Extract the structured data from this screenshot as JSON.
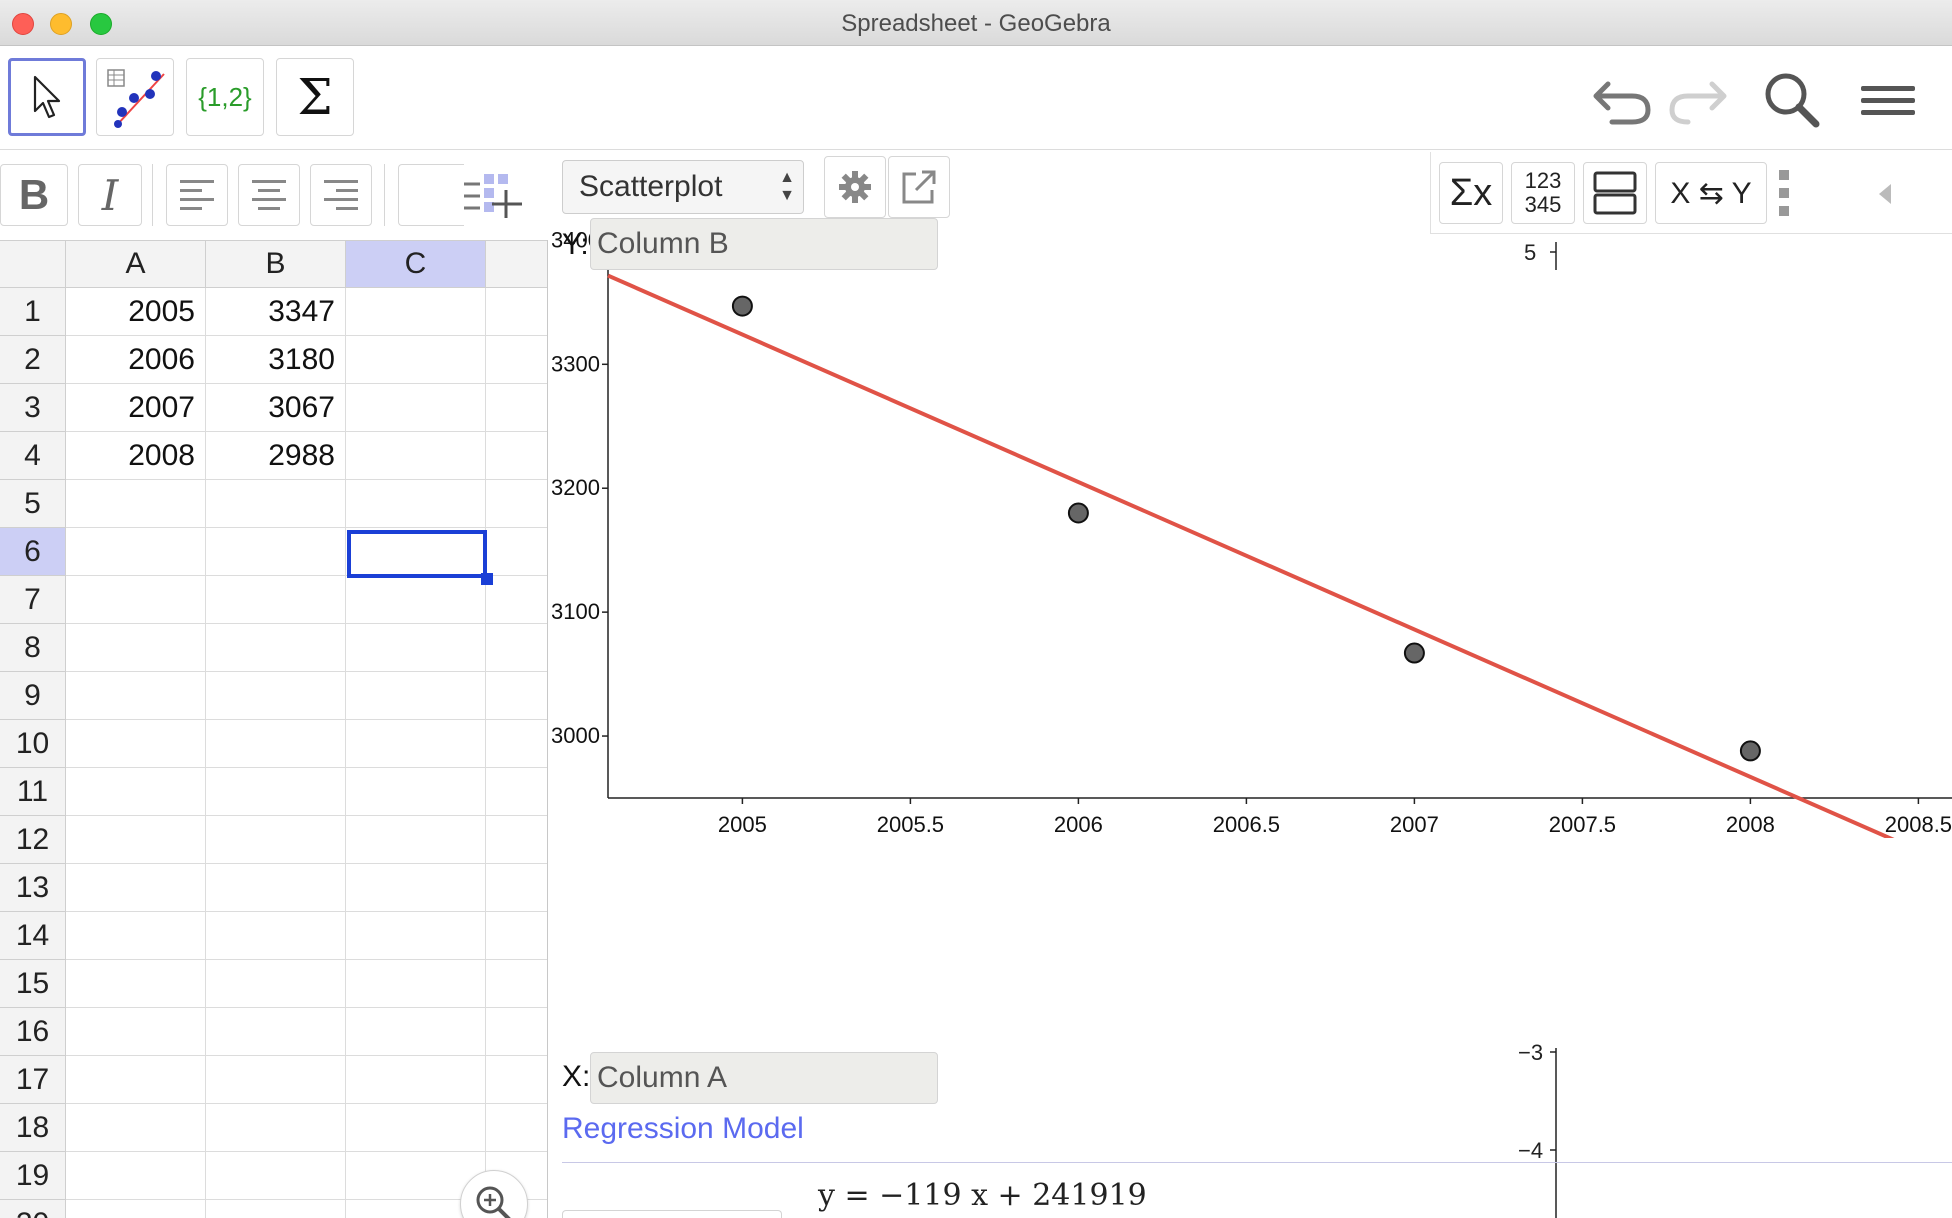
{
  "window": {
    "title": "Spreadsheet - GeoGebra"
  },
  "toolbar": {
    "tools": [
      "move-tool",
      "two-variable-regression-tool",
      "create-list-tool",
      "sum-tool"
    ],
    "list_label": "{1,2}",
    "sigma_label": "Σ"
  },
  "stylebar": {
    "bold": "B",
    "italic": "I"
  },
  "spreadsheet": {
    "columns": [
      "A",
      "B",
      "C"
    ],
    "selected_column": "C",
    "selected_row": "6",
    "rows": [
      {
        "n": "1",
        "a": "2005",
        "b": "3347"
      },
      {
        "n": "2",
        "a": "2006",
        "b": "3180"
      },
      {
        "n": "3",
        "a": "2007",
        "b": "3067"
      },
      {
        "n": "4",
        "a": "2008",
        "b": "2988"
      },
      {
        "n": "5",
        "a": "",
        "b": ""
      },
      {
        "n": "6",
        "a": "",
        "b": ""
      },
      {
        "n": "7",
        "a": "",
        "b": ""
      },
      {
        "n": "8",
        "a": "",
        "b": ""
      },
      {
        "n": "9",
        "a": "",
        "b": ""
      },
      {
        "n": "10",
        "a": "",
        "b": ""
      },
      {
        "n": "11",
        "a": "",
        "b": ""
      },
      {
        "n": "12",
        "a": "",
        "b": ""
      },
      {
        "n": "13",
        "a": "",
        "b": ""
      },
      {
        "n": "14",
        "a": "",
        "b": ""
      },
      {
        "n": "15",
        "a": "",
        "b": ""
      },
      {
        "n": "16",
        "a": "",
        "b": ""
      },
      {
        "n": "17",
        "a": "",
        "b": ""
      },
      {
        "n": "18",
        "a": "",
        "b": ""
      },
      {
        "n": "19",
        "a": "",
        "b": ""
      },
      {
        "n": "20",
        "a": "",
        "b": ""
      }
    ]
  },
  "analysis": {
    "plot_type": "Scatterplot",
    "y_label": "Y:",
    "y_value": "Column B",
    "x_label": "X:",
    "x_value": "Column A",
    "stats_buttons": {
      "sigma_x": "Σx",
      "data_123": "123",
      "data_345": "345",
      "swap": "X ⇆ Y"
    },
    "regression_label": "Regression Model",
    "regression_equation": "y = −119 x + 241919",
    "mini_axis_ticks": [
      "5",
      "−3",
      "−4"
    ]
  },
  "chart_data": {
    "type": "scatter",
    "title": "",
    "xlabel": "",
    "ylabel": "",
    "x": [
      2005,
      2006,
      2007,
      2008
    ],
    "y": [
      3347,
      3180,
      3067,
      2988
    ],
    "xlim": [
      2004.6,
      2008.6
    ],
    "ylim": [
      2950,
      3410
    ],
    "x_ticks": [
      2005,
      2005.5,
      2006,
      2006.5,
      2007,
      2007.5,
      2008,
      2008.5
    ],
    "y_ticks": [
      3000,
      3100,
      3200,
      3300,
      3400
    ],
    "regression": {
      "type": "linear",
      "slope": -119,
      "intercept": 241919,
      "color": "#e05347"
    },
    "point_color": "#666666",
    "grid": false
  }
}
